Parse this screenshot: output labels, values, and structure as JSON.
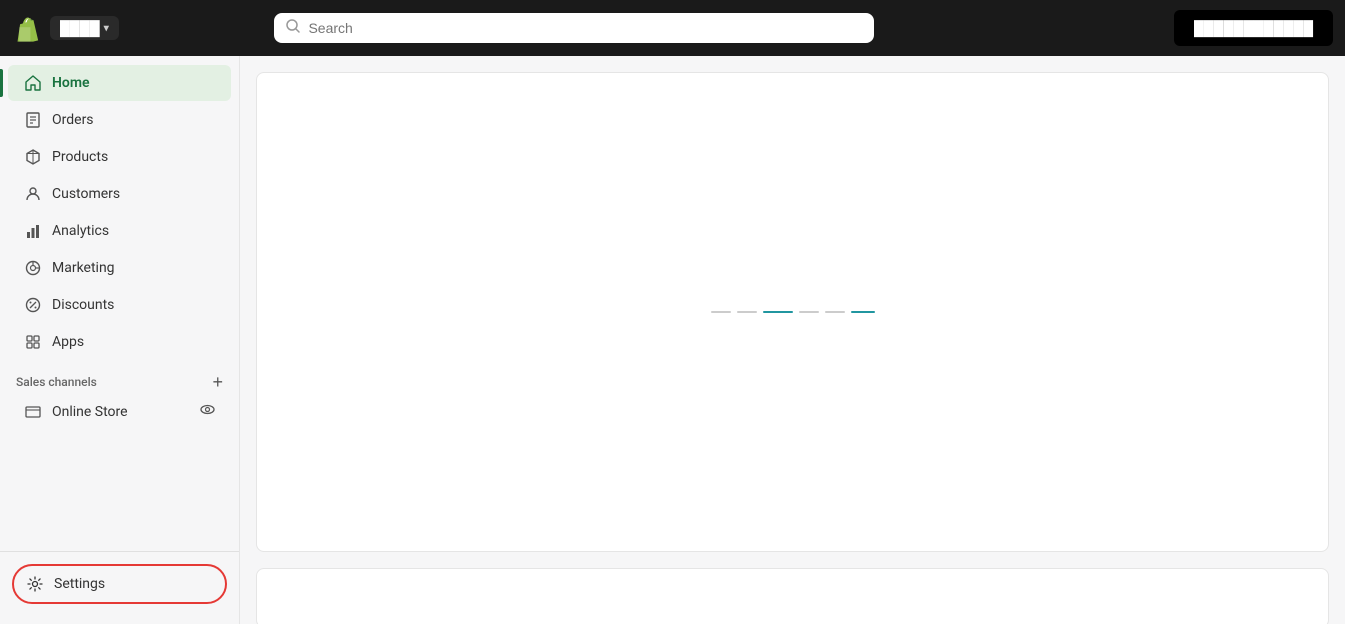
{
  "header": {
    "store_name": "████",
    "caret": "▾",
    "search_placeholder": "Search",
    "cta_label": "████████████"
  },
  "sidebar": {
    "nav_items": [
      {
        "id": "home",
        "label": "Home",
        "icon": "home",
        "active": true
      },
      {
        "id": "orders",
        "label": "Orders",
        "icon": "orders",
        "active": false
      },
      {
        "id": "products",
        "label": "Products",
        "icon": "products",
        "active": false
      },
      {
        "id": "customers",
        "label": "Customers",
        "icon": "customers",
        "active": false
      },
      {
        "id": "analytics",
        "label": "Analytics",
        "icon": "analytics",
        "active": false
      },
      {
        "id": "marketing",
        "label": "Marketing",
        "icon": "marketing",
        "active": false
      },
      {
        "id": "discounts",
        "label": "Discounts",
        "icon": "discounts",
        "active": false
      },
      {
        "id": "apps",
        "label": "Apps",
        "icon": "apps",
        "active": false
      }
    ],
    "sales_channels_title": "Sales channels",
    "add_channel_label": "+",
    "online_store_label": "Online Store",
    "settings_label": "Settings"
  },
  "content": {
    "main_card_min_height": 480,
    "secondary_card_min_height": 60
  }
}
